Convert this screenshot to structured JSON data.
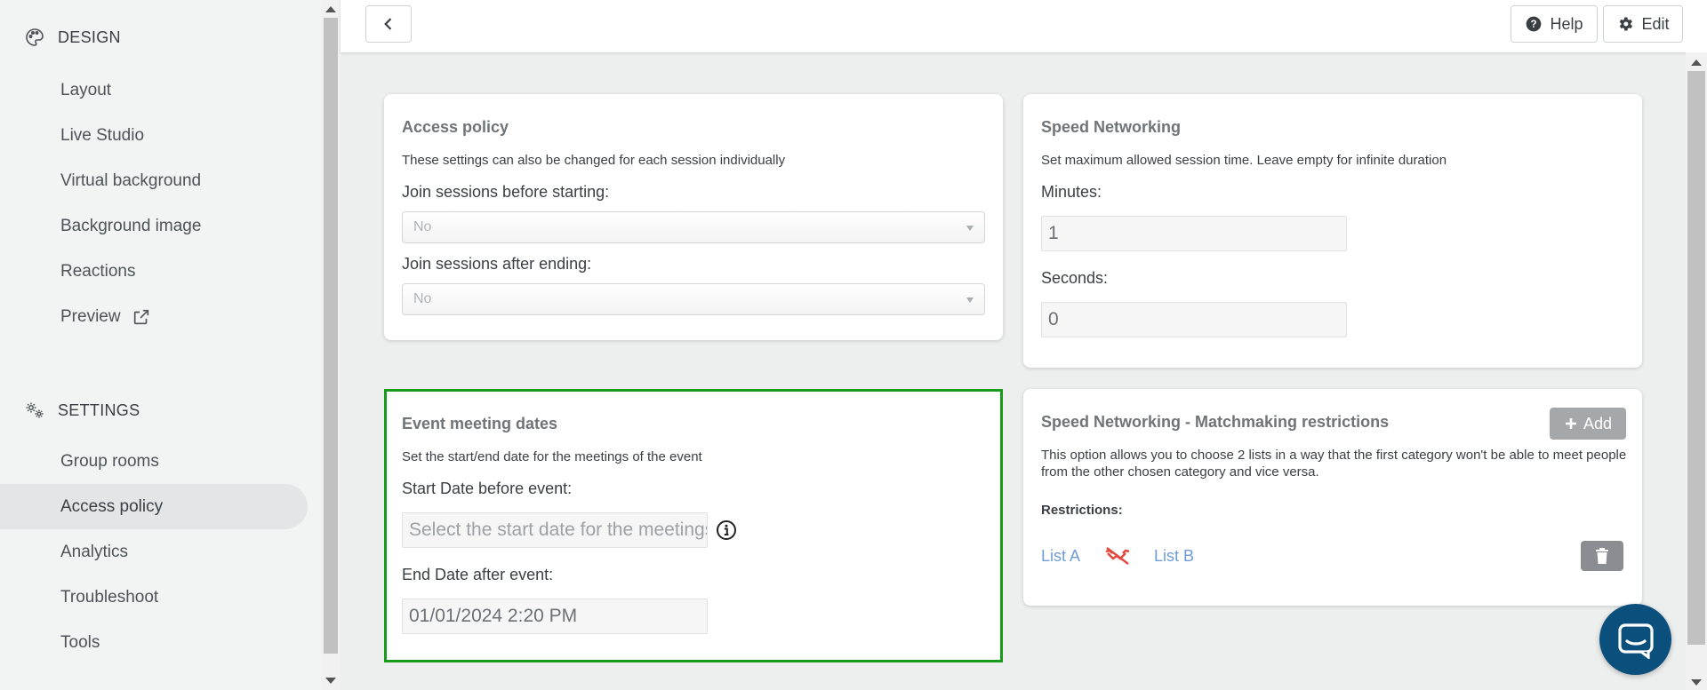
{
  "sidebar": {
    "design_heading": "DESIGN",
    "design_items": [
      "Layout",
      "Live Studio",
      "Virtual background",
      "Background image",
      "Reactions",
      "Preview"
    ],
    "settings_heading": "SETTINGS",
    "settings_items": [
      "Group rooms",
      "Access policy",
      "Analytics",
      "Troubleshoot",
      "Tools"
    ],
    "active_item": "Access policy"
  },
  "topbar": {
    "back_icon": "chevron-left-icon",
    "help_label": "Help",
    "edit_label": "Edit"
  },
  "access_policy": {
    "title": "Access policy",
    "description": "These settings can also be changed for each session individually",
    "join_before_label": "Join sessions before starting:",
    "join_before_value": "No",
    "join_after_label": "Join sessions after ending:",
    "join_after_value": "No"
  },
  "speed_networking": {
    "title": "Speed Networking",
    "description": "Set maximum allowed session time. Leave empty for infinite duration",
    "minutes_label": "Minutes:",
    "minutes_value": "1",
    "seconds_label": "Seconds:",
    "seconds_value": "0"
  },
  "event_meeting_dates": {
    "title": "Event meeting dates",
    "description": "Set the start/end date for the meetings of the event",
    "start_label": "Start Date before event:",
    "start_placeholder": "Select the start date for the meetings",
    "end_label": "End Date after event:",
    "end_value": "01/01/2024 2:20 PM",
    "highlight_color": "#1a9a1a"
  },
  "matchmaking": {
    "title": "Speed Networking - Matchmaking restrictions",
    "add_label": "Add",
    "description": "This option allows you to choose 2 lists in a way that the first category won't be able to meet people from the other chosen category and vice versa.",
    "restrictions_label": "Restrictions:",
    "list_a": "List A",
    "list_b": "List B",
    "restriction_icon": "no-meeting-icon"
  },
  "colors": {
    "link": "#6f9cd6",
    "chat_bubble": "#0b4f7d",
    "restriction_icon": "#e2483d"
  }
}
